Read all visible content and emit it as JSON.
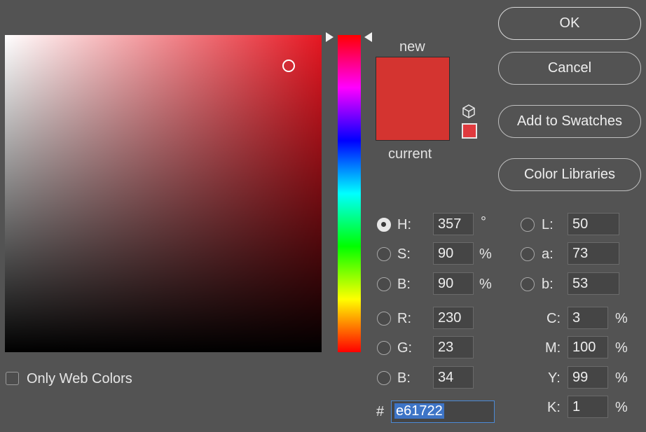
{
  "picker": {
    "new_label": "new",
    "current_label": "current",
    "new_color": "#d43430",
    "websafe_color": "#e03a3e",
    "only_web_colors_label": "Only Web Colors",
    "only_web_colors_checked": false
  },
  "buttons": {
    "ok": "OK",
    "cancel": "Cancel",
    "add_to_swatches": "Add to Swatches",
    "color_libraries": "Color Libraries"
  },
  "hsb": {
    "h": {
      "label": "H:",
      "value": "357",
      "unit": "°",
      "selected": true
    },
    "s": {
      "label": "S:",
      "value": "90",
      "unit": "%"
    },
    "b": {
      "label": "B:",
      "value": "90",
      "unit": "%"
    }
  },
  "rgb": {
    "r": {
      "label": "R:",
      "value": "230"
    },
    "g": {
      "label": "G:",
      "value": "23"
    },
    "b": {
      "label": "B:",
      "value": "34"
    }
  },
  "lab": {
    "l": {
      "label": "L:",
      "value": "50"
    },
    "a": {
      "label": "a:",
      "value": "73"
    },
    "b": {
      "label": "b:",
      "value": "53"
    }
  },
  "cmyk": {
    "c": {
      "label": "C:",
      "value": "3",
      "unit": "%"
    },
    "m": {
      "label": "M:",
      "value": "100",
      "unit": "%"
    },
    "y": {
      "label": "Y:",
      "value": "99",
      "unit": "%"
    },
    "k": {
      "label": "K:",
      "value": "1",
      "unit": "%"
    }
  },
  "hex": {
    "label": "#",
    "value": "e61722"
  },
  "icons": {
    "cube": "gamut-cube-icon",
    "websafe": "web-safe-swatch"
  }
}
